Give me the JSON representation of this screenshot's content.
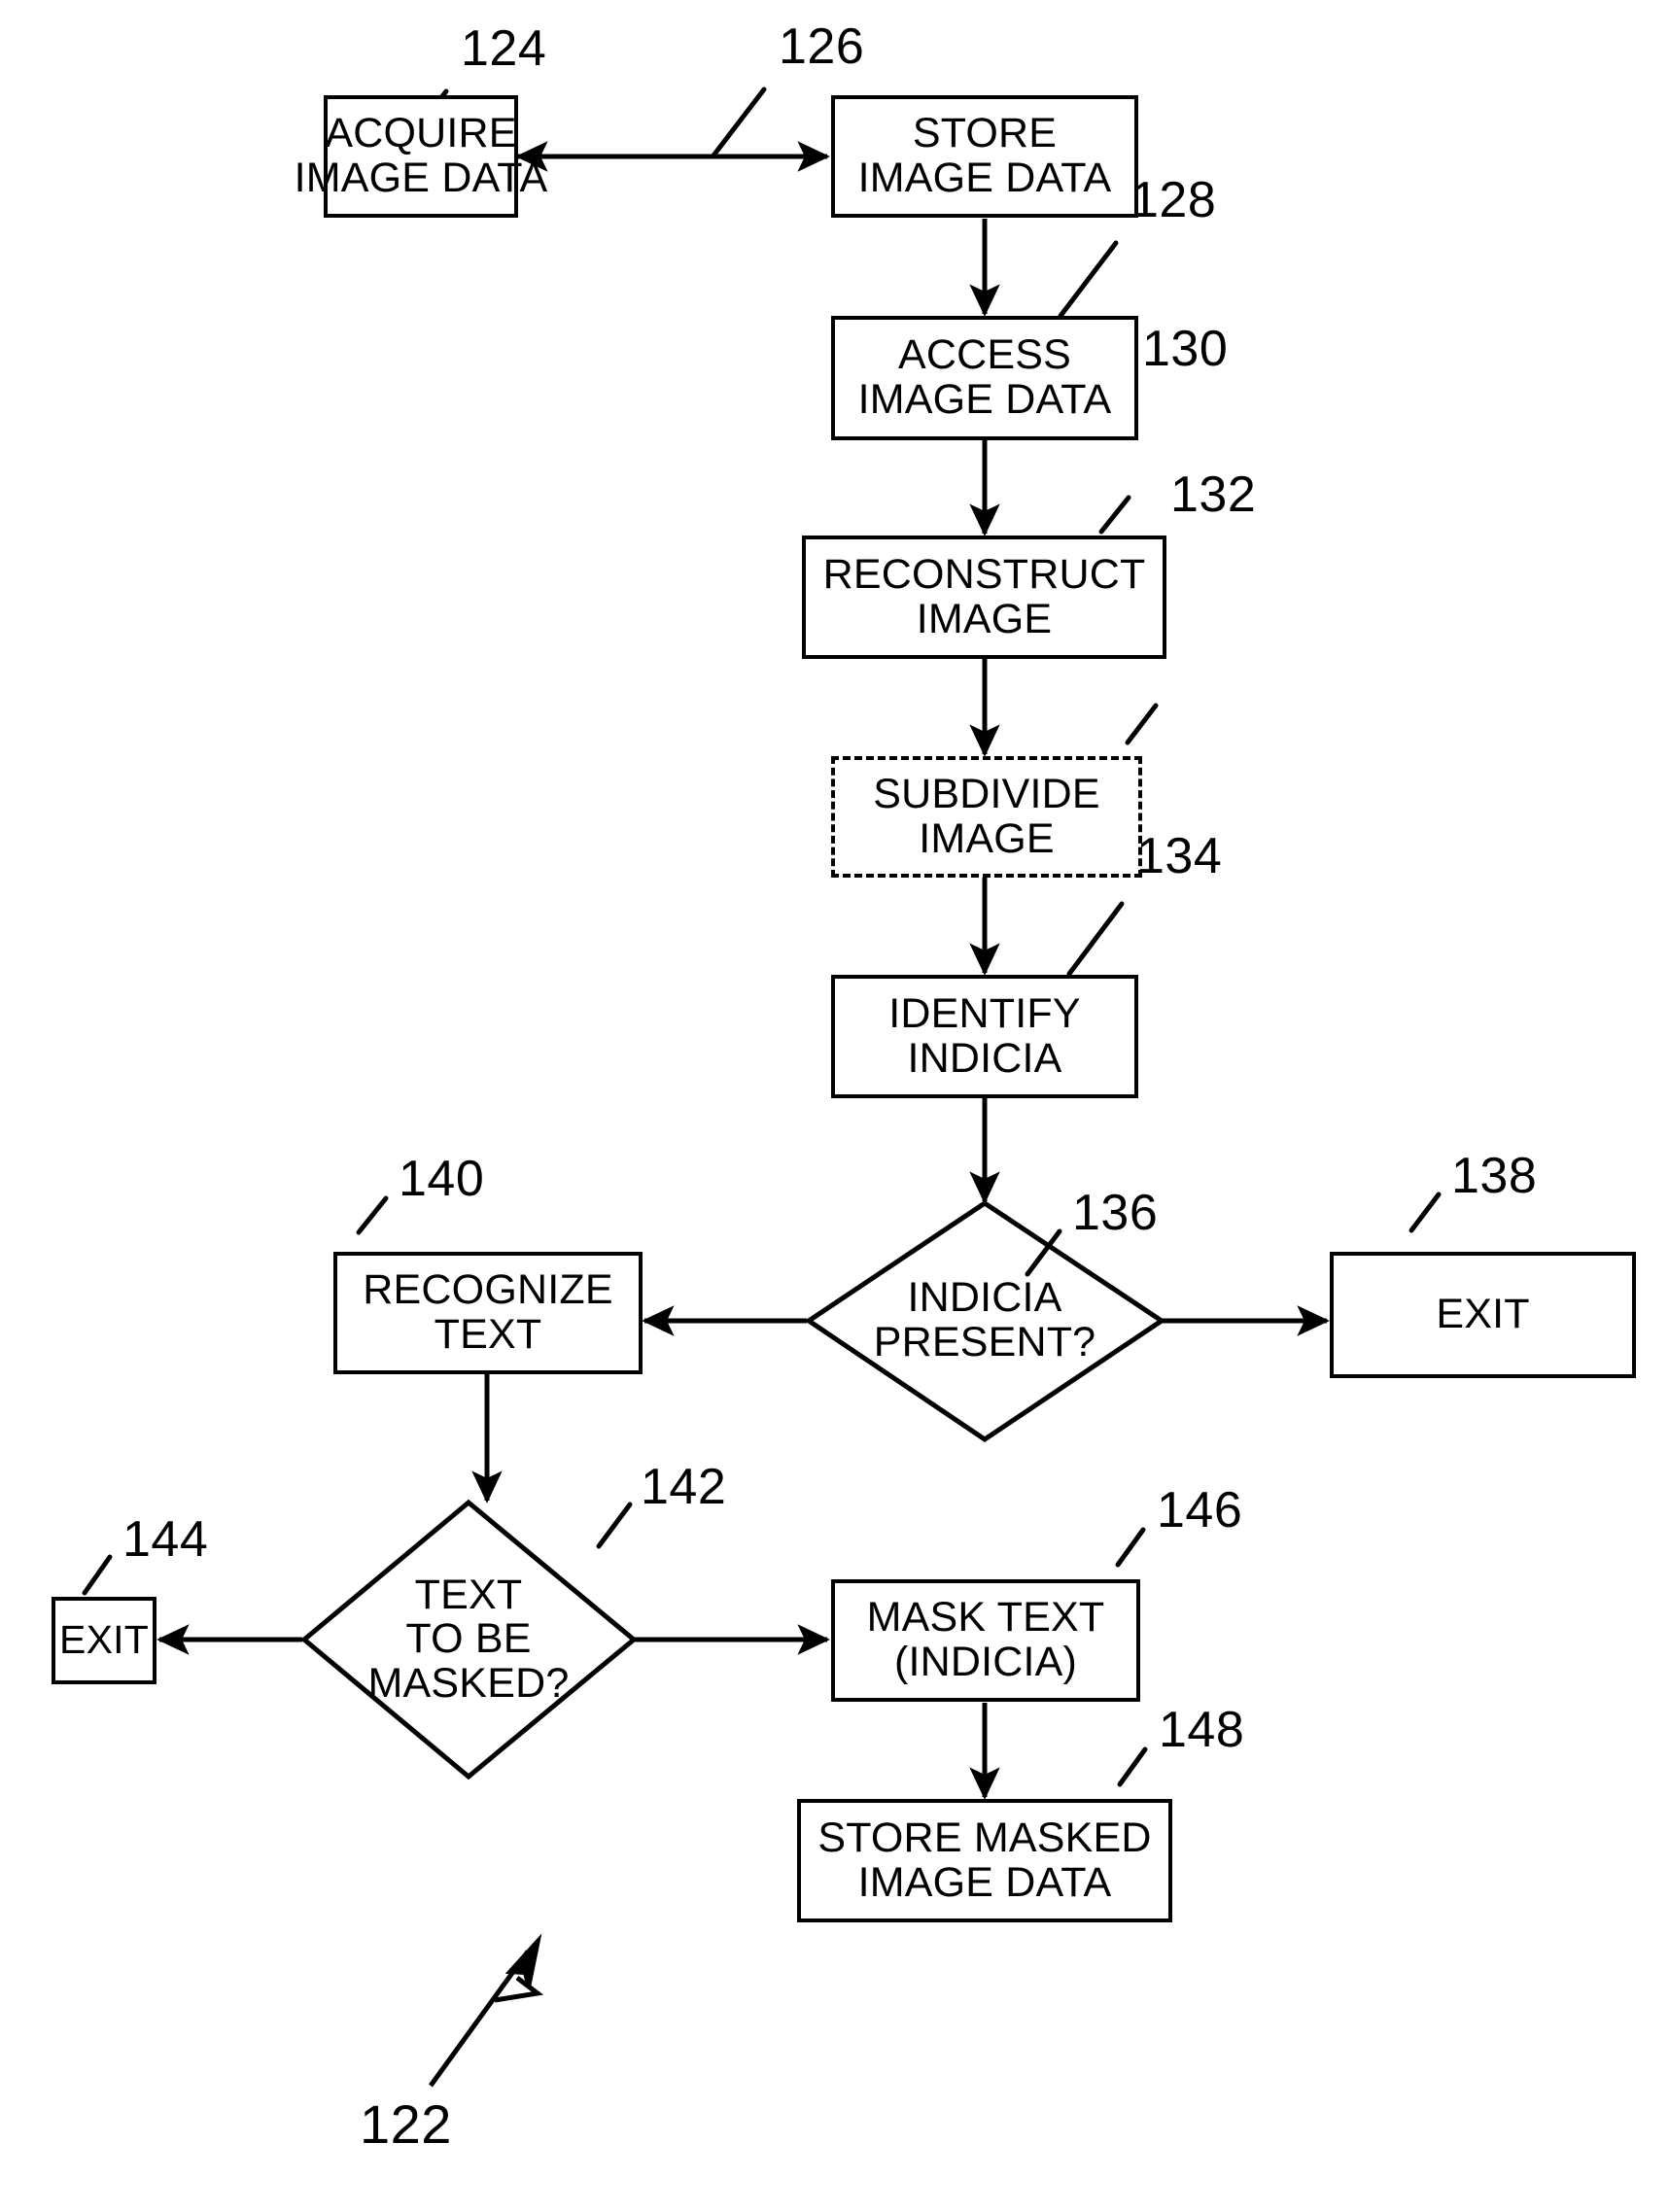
{
  "figure": {
    "label": "122",
    "title": "Image indicia masking process flowchart"
  },
  "nodes": [
    {
      "id": "acquire-image-data",
      "ref": "124",
      "shape": "process",
      "lines": [
        "ACQUIRE",
        "IMAGE DATA"
      ]
    },
    {
      "id": "store-image-data",
      "ref": "126",
      "shape": "process",
      "lines": [
        "STORE",
        "IMAGE DATA"
      ]
    },
    {
      "id": "access-image-data",
      "ref": "128",
      "shape": "process",
      "lines": [
        "ACCESS",
        "IMAGE DATA"
      ]
    },
    {
      "id": "reconstruct-image",
      "ref": "130",
      "shape": "process",
      "lines": [
        "RECONSTRUCT",
        "IMAGE"
      ]
    },
    {
      "id": "subdivide-image",
      "ref": "132",
      "shape": "process-optional",
      "lines": [
        "SUBDIVIDE",
        "IMAGE"
      ]
    },
    {
      "id": "identify-indicia",
      "ref": "134",
      "shape": "process",
      "lines": [
        "IDENTIFY",
        "INDICIA"
      ]
    },
    {
      "id": "indicia-present",
      "ref": "136",
      "shape": "decision",
      "lines": [
        "INDICIA",
        "PRESENT?"
      ]
    },
    {
      "id": "exit-138",
      "ref": "138",
      "shape": "terminal",
      "lines": [
        "EXIT"
      ]
    },
    {
      "id": "recognize-text",
      "ref": "140",
      "shape": "process",
      "lines": [
        "RECOGNIZE",
        "TEXT"
      ]
    },
    {
      "id": "text-to-be-masked",
      "ref": "142",
      "shape": "decision",
      "lines": [
        "TEXT",
        "TO BE",
        "MASKED?"
      ]
    },
    {
      "id": "exit-144",
      "ref": "144",
      "shape": "terminal",
      "lines": [
        "EXIT"
      ]
    },
    {
      "id": "mask-text-indicia",
      "ref": "146",
      "shape": "process",
      "lines": [
        "MASK TEXT",
        "(INDICIA)"
      ]
    },
    {
      "id": "store-masked-image-data",
      "ref": "148",
      "shape": "process",
      "lines": [
        "STORE MASKED",
        "IMAGE DATA"
      ]
    }
  ],
  "colors": {
    "line": "#000000",
    "background": "#ffffff",
    "text": "#000000"
  }
}
